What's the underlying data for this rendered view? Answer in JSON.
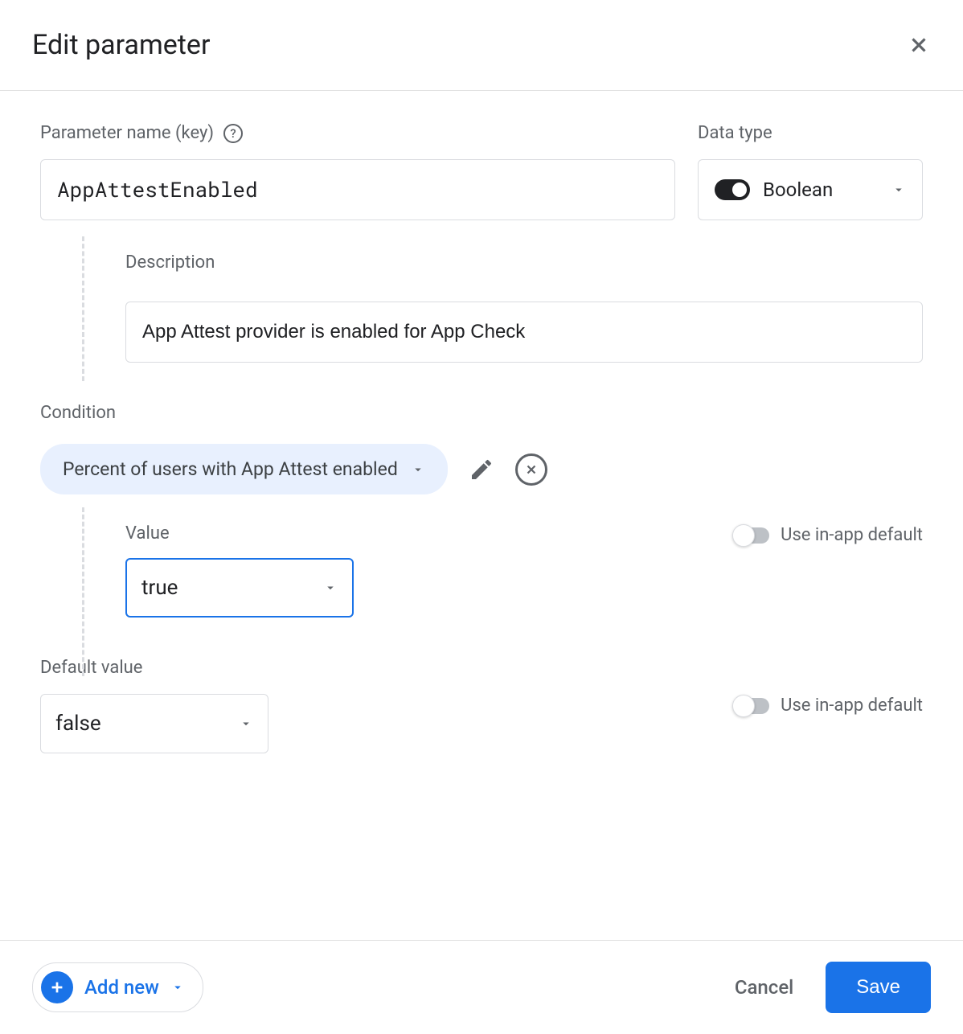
{
  "header": {
    "title": "Edit parameter"
  },
  "param": {
    "name_label": "Parameter name (key)",
    "name_value": "AppAttestEnabled",
    "data_type_label": "Data type",
    "data_type_value": "Boolean",
    "description_label": "Description",
    "description_value": "App Attest provider is enabled for App Check"
  },
  "condition": {
    "section_label": "Condition",
    "chip_text": "Percent of users with App Attest enabled",
    "value_label": "Value",
    "value_selected": "true",
    "use_inapp_label": "Use in-app default"
  },
  "default": {
    "label": "Default value",
    "value_selected": "false",
    "use_inapp_label": "Use in-app default"
  },
  "footer": {
    "add_new_label": "Add new",
    "cancel_label": "Cancel",
    "save_label": "Save"
  }
}
